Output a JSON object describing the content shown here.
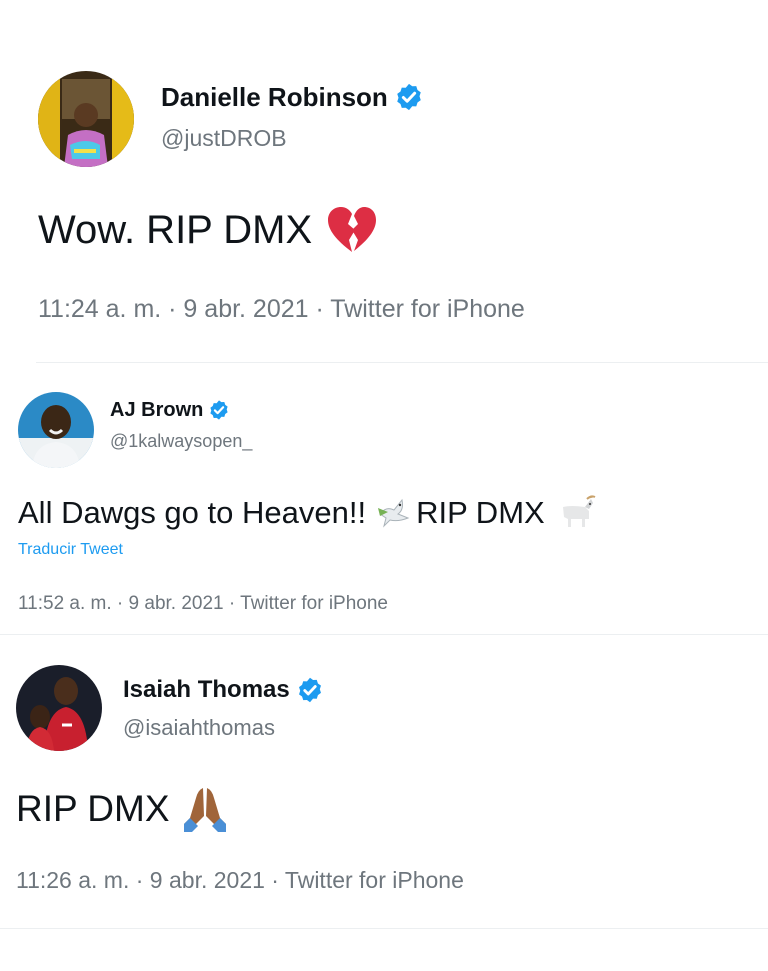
{
  "colors": {
    "verified_badge": "#1d9bf0",
    "link": "#1d9bf0",
    "secondary_text": "#6e767d",
    "primary_text": "#0f1419"
  },
  "tweets": [
    {
      "display_name": "Danielle Robinson",
      "handle": "@justDROB",
      "text": "Wow. RIP DMX",
      "emoji_after": "broken-heart-icon",
      "meta": "11:24 a. m. · 9 abr. 2021 · Twitter for iPhone"
    },
    {
      "display_name": "AJ Brown",
      "handle": "@1kalwaysopen_",
      "text_before": "All Dawgs go to Heaven!!",
      "emoji_middle": "dove-icon",
      "text_after": "RIP DMX",
      "emoji_after": "goat-icon",
      "translate_label": "Traducir Tweet",
      "meta": "11:52 a. m. · 9 abr. 2021 · Twitter for iPhone"
    },
    {
      "display_name": "Isaiah Thomas",
      "handle": "@isaiahthomas",
      "text": "RIP DMX",
      "emoji_after": "praying-hands-icon",
      "meta": "11:26 a. m. · 9 abr. 2021 · Twitter for iPhone"
    }
  ]
}
